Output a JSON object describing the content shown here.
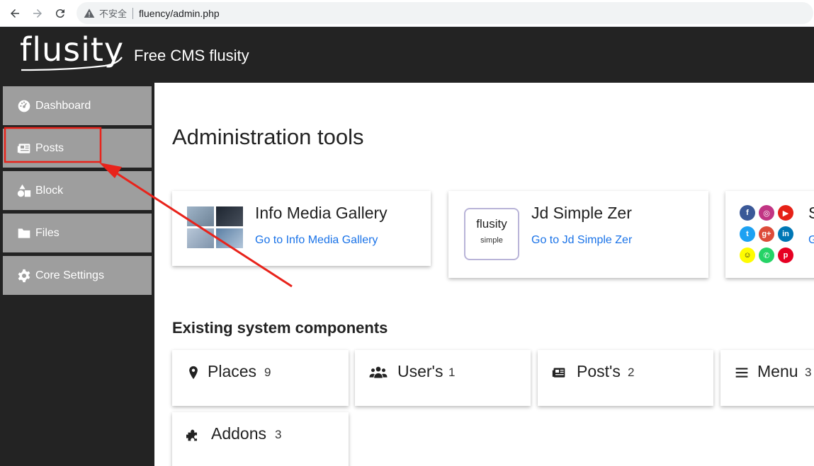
{
  "browser": {
    "security_label": "不安全",
    "url": "fluency/admin.php"
  },
  "header": {
    "logo": "flusity",
    "tagline": "Free CMS flusity"
  },
  "sidebar": {
    "items": [
      {
        "label": "Dashboard",
        "icon": "dashboard-icon"
      },
      {
        "label": "Posts",
        "icon": "newspaper-icon"
      },
      {
        "label": "Block",
        "icon": "shapes-icon"
      },
      {
        "label": "Files",
        "icon": "folder-icon"
      },
      {
        "label": "Core Settings",
        "icon": "gear-icon"
      }
    ]
  },
  "main": {
    "title": "Administration tools",
    "tools": [
      {
        "name": "Info Media Gallery",
        "link": "Go to Info Media Gallery"
      },
      {
        "name": "Jd Simple Zer",
        "link": "Go to Jd Simple Zer",
        "thumb_title": "flusity",
        "thumb_sub": "simple"
      },
      {
        "name": "S",
        "link": "Go"
      }
    ],
    "components_title": "Existing system components",
    "components": [
      {
        "label": "Places",
        "count": "9",
        "icon": "map-marker-icon"
      },
      {
        "label": "User's",
        "count": "1",
        "icon": "users-icon"
      },
      {
        "label": "Post's",
        "count": "2",
        "icon": "newspaper-icon"
      },
      {
        "label": "Menu",
        "count": "3",
        "icon": "bars-icon"
      },
      {
        "label": "Addons",
        "count": "3",
        "icon": "puzzle-icon"
      }
    ]
  },
  "colors": {
    "sidebar_item_bg": "#9e9e9e",
    "header_bg": "#232323",
    "link": "#1a73e8",
    "annotation": "#e8231b"
  }
}
